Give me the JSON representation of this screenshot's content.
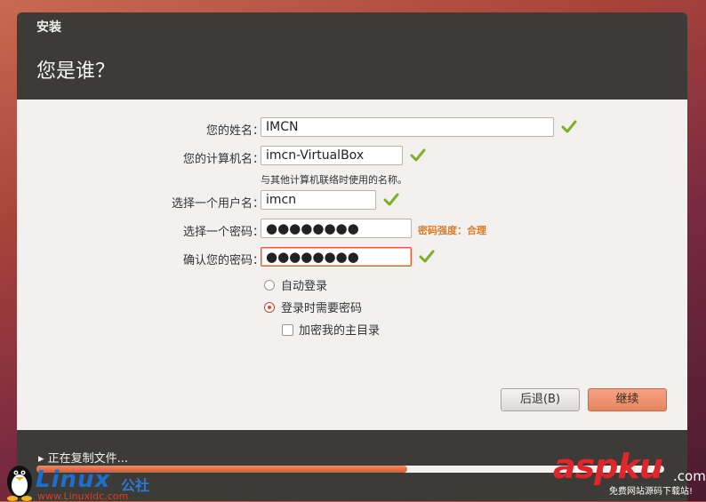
{
  "window": {
    "title": "安装",
    "heading": "您是谁？"
  },
  "form": {
    "name_label": "您的姓名：",
    "name_value": "IMCN",
    "computer_label": "您的计算机名：",
    "computer_value": "imcn-VirtualBox",
    "computer_hint": "与其他计算机联络时使用的名称。",
    "username_label": "选择一个用户名：",
    "username_value": "imcn",
    "password_label": "选择一个密码：",
    "password_value": "●●●●●●●●",
    "password_strength": "密码强度：合理",
    "confirm_label": "确认您的密码：",
    "confirm_value": "●●●●●●●●"
  },
  "login": {
    "auto_login": "自动登录",
    "require_password": "登录时需要密码",
    "encrypt_home": "加密我的主目录",
    "selected": "require_password",
    "encrypt_checked": false
  },
  "buttons": {
    "back": "后退(B)",
    "continue": "继续"
  },
  "footer": {
    "status": "▸ 正在复制文件...",
    "progress": 0.59
  },
  "watermarks": {
    "left_brand": "Linux",
    "left_brand_suffix": "公社",
    "left_url": "www.Linuxidc.com",
    "right_brand": "aspku",
    "right_tld": ".com",
    "right_slogan": "免费网站源码下载站!"
  },
  "colors": {
    "accent": "#e05a36",
    "check": "#7fae2a",
    "strength": "#e47a22"
  }
}
